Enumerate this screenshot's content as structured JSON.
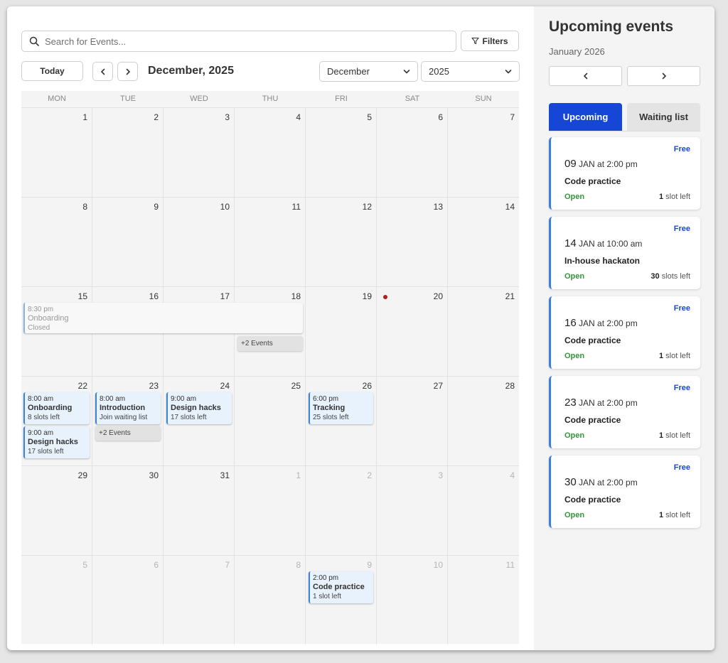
{
  "search": {
    "placeholder": "Search for Events..."
  },
  "toolbar": {
    "filters_label": "Filters",
    "today_label": "Today",
    "month_title": "December, 2025",
    "month_select": "December",
    "year_select": "2025"
  },
  "calendar": {
    "weekdays": [
      "MON",
      "TUE",
      "WED",
      "THU",
      "FRI",
      "SAT",
      "SUN"
    ],
    "weeks": [
      [
        "1",
        "2",
        "3",
        "4",
        "5",
        "6",
        "7"
      ],
      [
        "8",
        "9",
        "10",
        "11",
        "12",
        "13",
        "14"
      ],
      [
        "15",
        "16",
        "17",
        "18",
        "19",
        "20",
        "21"
      ],
      [
        "22",
        "23",
        "24",
        "25",
        "26",
        "27",
        "28"
      ],
      [
        "29",
        "30",
        "31",
        "1",
        "2",
        "3",
        "4"
      ],
      [
        "5",
        "6",
        "7",
        "8",
        "9",
        "10",
        "11"
      ]
    ],
    "events": {
      "onboarding_closed": {
        "time": "8:30 pm",
        "name": "Onboarding",
        "status": "Closed"
      },
      "more_18": "+2 Events",
      "onboarding_22": {
        "time": "8:00 am",
        "name": "Onboarding",
        "status": "8 slots left"
      },
      "design_22": {
        "time": "9:00 am",
        "name": "Design hacks",
        "status": "17 slots left"
      },
      "intro_23": {
        "time": "8:00 am",
        "name": "Introduction",
        "status": "Join waiting list"
      },
      "more_23": "+2 Events",
      "design_24": {
        "time": "9:00 am",
        "name": "Design hacks",
        "status": "17 slots left"
      },
      "tracking_26": {
        "time": "6:00 pm",
        "name": "Tracking",
        "status": "25 slots left"
      },
      "code_jan9": {
        "time": "2:00 pm",
        "name": "Code practice",
        "status": "1 slot left"
      }
    }
  },
  "sidebar": {
    "title": "Upcoming events",
    "month": "January 2026",
    "tabs": [
      "Upcoming",
      "Waiting list"
    ],
    "cards": [
      {
        "price": "Free",
        "day": "09",
        "date_rest": " JAN at 2:00 pm",
        "name": "Code practice",
        "status": "Open",
        "slots_num": "1",
        "slots_text": " slot left"
      },
      {
        "price": "Free",
        "day": "14",
        "date_rest": " JAN at 10:00 am",
        "name": "In-house hackaton",
        "status": "Open",
        "slots_num": "30",
        "slots_text": " slots left"
      },
      {
        "price": "Free",
        "day": "16",
        "date_rest": " JAN at 2:00 pm",
        "name": "Code practice",
        "status": "Open",
        "slots_num": "1",
        "slots_text": " slot left"
      },
      {
        "price": "Free",
        "day": "23",
        "date_rest": " JAN at 2:00 pm",
        "name": "Code practice",
        "status": "Open",
        "slots_num": "1",
        "slots_text": " slot left"
      },
      {
        "price": "Free",
        "day": "30",
        "date_rest": " JAN at 2:00 pm",
        "name": "Code practice",
        "status": "Open",
        "slots_num": "1",
        "slots_text": " slot left"
      }
    ]
  },
  "colors": {
    "accent": "#1546d6",
    "event_border": "#3c82d6",
    "event_bg": "#e8f2fd",
    "open_status": "#2d9a3a",
    "today_dot": "#b71c1c"
  },
  "icons": {
    "search": "search-icon",
    "filter": "filter-icon",
    "prev": "chevron-left-icon",
    "next": "chevron-right-icon",
    "dropdown": "chevron-down-icon"
  }
}
